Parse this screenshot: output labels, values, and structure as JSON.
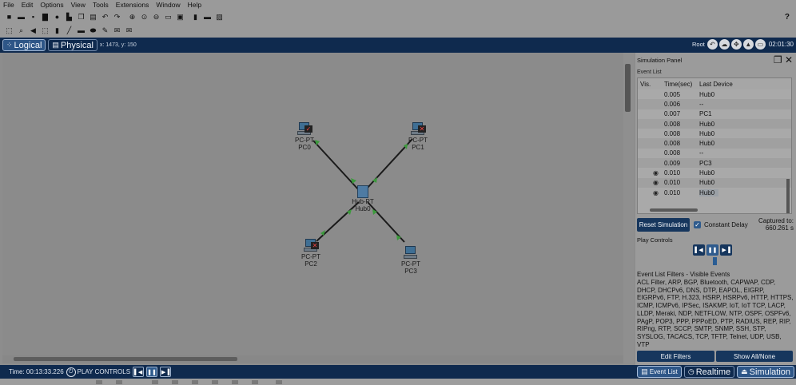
{
  "menu": [
    "File",
    "Edit",
    "Options",
    "View",
    "Tools",
    "Extensions",
    "Window",
    "Help"
  ],
  "toolbar": {
    "help_label": "?"
  },
  "modebar": {
    "logical_label": "Logical",
    "physical_label": "Physical",
    "coords": "x: 1473, y: 150",
    "root_label": "Root",
    "clock": "02:01:30"
  },
  "topology": {
    "nodes": [
      {
        "type": "PC-PT",
        "name": "PC0"
      },
      {
        "type": "PC-PT",
        "name": "PC1"
      },
      {
        "type": "Hub-PT",
        "name": "Hub0"
      },
      {
        "type": "PC-PT",
        "name": "PC2"
      },
      {
        "type": "PC-PT",
        "name": "PC3"
      }
    ],
    "link_color": "#1a1a1a",
    "port_color": "#3c9a3c"
  },
  "panel": {
    "title": "Simulation Panel",
    "event_list_label": "Event List",
    "columns": [
      "Vis.",
      "Time(sec)",
      "Last Device"
    ],
    "events": [
      {
        "vis": "",
        "time": "0.005",
        "device": "Hub0"
      },
      {
        "vis": "",
        "time": "0.006",
        "device": "--"
      },
      {
        "vis": "",
        "time": "0.007",
        "device": "PC1"
      },
      {
        "vis": "",
        "time": "0.008",
        "device": "Hub0"
      },
      {
        "vis": "",
        "time": "0.008",
        "device": "Hub0"
      },
      {
        "vis": "",
        "time": "0.008",
        "device": "Hub0"
      },
      {
        "vis": "",
        "time": "0.008",
        "device": "--"
      },
      {
        "vis": "",
        "time": "0.009",
        "device": "PC3"
      },
      {
        "vis": "eye",
        "time": "0.010",
        "device": "Hub0"
      },
      {
        "vis": "eye",
        "time": "0.010",
        "device": "Hub0"
      },
      {
        "vis": "eye",
        "time": "0.010",
        "device": "Hub0"
      }
    ],
    "reset_label": "Reset Simulation",
    "constant_delay_label": "Constant Delay",
    "captured_line1": "Captured to:",
    "captured_line2": "660.261 s",
    "play_controls_label": "Play Controls",
    "filters_title": "Event List Filters - Visible Events",
    "filters_text": "ACL Filter, ARP, BGP, Bluetooth, CAPWAP, CDP, DHCP, DHCPv6, DNS, DTP, EAPOL, EIGRP, EIGRPv6, FTP, H.323, HSRP, HSRPv6, HTTP, HTTPS, ICMP, ICMPv6, IPSec, ISAKMP, IoT, IoT TCP, LACP, LLDP, Meraki, NDP, NETFLOW, NTP, OSPF, OSPFv6, PAgP, POP3, PPP, PPPoED, PTP, RADIUS, REP, RIP, RIPng, RTP, SCCP, SMTP, SNMP, SSH, STP, SYSLOG, TACACS, TCP, TFTP, Telnet, UDP, USB, VTP",
    "edit_filters_label": "Edit Filters",
    "show_all_label": "Show All/None"
  },
  "statusbar": {
    "time_label": "Time: 00:13:33.226",
    "play_controls_label": "PLAY CONTROLS",
    "event_list_tab": "Event List",
    "realtime_tab": "Realtime",
    "simulation_tab": "Simulation"
  },
  "colors": {
    "navy": "#0f2a4e",
    "button_navy": "#16365d",
    "accent_blue": "#2f5b8d"
  }
}
